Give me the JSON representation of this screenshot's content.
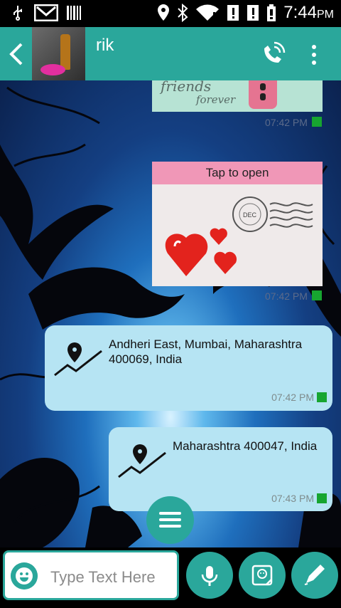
{
  "status_bar": {
    "time": "7:44",
    "ampm": "PM"
  },
  "header": {
    "contact_name": "rik"
  },
  "messages": {
    "sticker_top": {
      "text_line1": "friends",
      "text_line2": "forever",
      "time": "07:42 PM"
    },
    "card": {
      "tap_label": "Tap to open",
      "stamp_text": "DEC",
      "time": "07:42 PM"
    },
    "location1": {
      "address": "Andheri East, Mumbai, Maharashtra 400069, India",
      "time": "07:42 PM"
    },
    "location2": {
      "address": "Maharashtra 400047, India",
      "time": "07:43 PM"
    }
  },
  "composer": {
    "placeholder": "Type Text Here"
  },
  "colors": {
    "accent": "#2aa79b",
    "sent_status": "#17a530",
    "bubble": "#b6e4f3"
  },
  "icons": {
    "back": "back-arrow-icon",
    "call": "phone-call-icon",
    "more": "more-vert-icon",
    "menu": "menu-icon",
    "emoji": "smiley-icon",
    "mic": "mic-icon",
    "sticker": "sticker-icon",
    "pen": "pen-icon",
    "location": "map-pin-icon"
  }
}
